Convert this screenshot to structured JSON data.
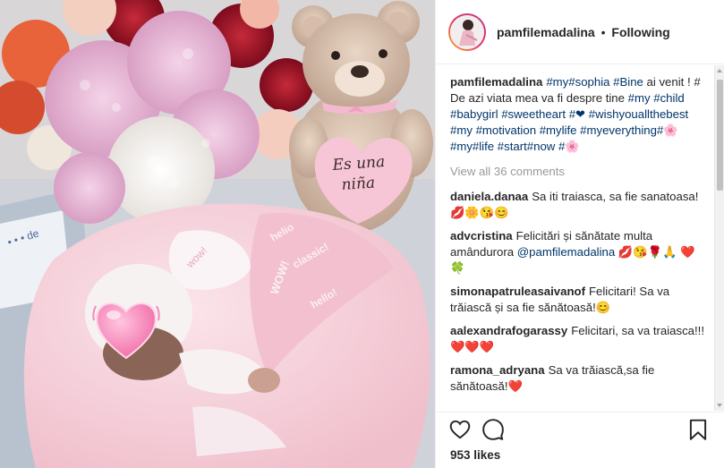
{
  "post": {
    "username": "pamfilemadalina",
    "separator": "•",
    "follow_status": "Following",
    "photo_overlay": {
      "sticker_emoji": "💗",
      "teddy_heart_text": "Es una niña"
    }
  },
  "caption": {
    "username": "pamfilemadalina",
    "segments": [
      {
        "type": "tag",
        "text": "#my"
      },
      {
        "type": "tag",
        "text": "#sophia"
      },
      {
        "type": "text",
        "text": " "
      },
      {
        "type": "tag",
        "text": "#Bine"
      },
      {
        "type": "text",
        "text": " ai venit ! # De azi viata mea va fi despre tine "
      },
      {
        "type": "tag",
        "text": "#my"
      },
      {
        "type": "text",
        "text": " "
      },
      {
        "type": "tag",
        "text": "#child"
      },
      {
        "type": "text",
        "text": " "
      },
      {
        "type": "tag",
        "text": "#babygirl"
      },
      {
        "type": "text",
        "text": " "
      },
      {
        "type": "tag",
        "text": "#sweetheart"
      },
      {
        "type": "text",
        "text": " "
      },
      {
        "type": "tag",
        "text": "#❤"
      },
      {
        "type": "text",
        "text": " "
      },
      {
        "type": "tag",
        "text": "#wishyouallthebest"
      },
      {
        "type": "text",
        "text": " "
      },
      {
        "type": "tag",
        "text": "#my"
      },
      {
        "type": "text",
        "text": " "
      },
      {
        "type": "tag",
        "text": "#motivation"
      },
      {
        "type": "text",
        "text": " "
      },
      {
        "type": "tag",
        "text": "#mylife"
      },
      {
        "type": "text",
        "text": " "
      },
      {
        "type": "tag",
        "text": "#myeverything"
      },
      {
        "type": "tag",
        "text": "#🌸"
      },
      {
        "type": "text",
        "text": " "
      },
      {
        "type": "tag",
        "text": "#my"
      },
      {
        "type": "tag",
        "text": "#life"
      },
      {
        "type": "text",
        "text": " "
      },
      {
        "type": "tag",
        "text": "#start"
      },
      {
        "type": "tag",
        "text": "#now"
      },
      {
        "type": "text",
        "text": " "
      },
      {
        "type": "tag",
        "text": "#🌸"
      }
    ]
  },
  "view_all_comments": "View all 36 comments",
  "comments": [
    {
      "username": "daniela.danaa",
      "segments": [
        {
          "type": "text",
          "text": "Sa iti traiasca, sa fie sanatoasa! 💋🌼😘😊"
        }
      ]
    },
    {
      "username": "advcristina",
      "segments": [
        {
          "type": "text",
          "text": "Felicitări și sănătate multa amândurora "
        },
        {
          "type": "mention",
          "text": "@pamfilemadalina"
        },
        {
          "type": "text",
          "text": " 💋😘🌹🙏 ❤️🍀"
        }
      ]
    },
    {
      "username": "simonapatruleasaivanof",
      "segments": [
        {
          "type": "text",
          "text": "Felicitari! Sa va trăiască și sa fie sănătoasă!😊"
        }
      ]
    },
    {
      "username": "aalexandrafogarassy",
      "segments": [
        {
          "type": "text",
          "text": "Felicitari, sa va traiasca!!! ❤️❤️❤️"
        }
      ]
    },
    {
      "username": "ramona_adryana",
      "segments": [
        {
          "type": "text",
          "text": "Sa va trăiască,sa fie sănătoasă!❤️"
        }
      ]
    }
  ],
  "actions": {
    "like_icon": "heart-outline-icon",
    "comment_icon": "comment-bubble-icon",
    "save_icon": "bookmark-icon",
    "likes_text": "953 likes"
  },
  "colors": {
    "link": "#003569",
    "muted": "#999999",
    "text": "#262626",
    "border": "#efefef"
  }
}
